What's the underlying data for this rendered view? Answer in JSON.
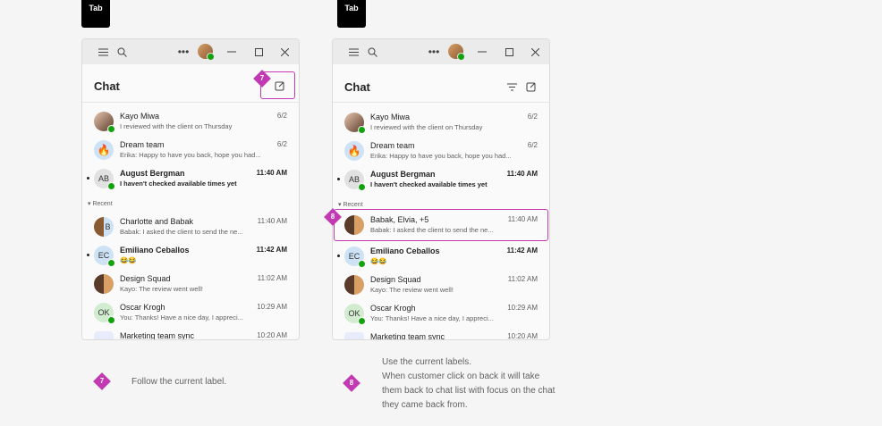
{
  "badges": {
    "tab_left": "Tab",
    "tab_right": "Tab"
  },
  "chat": {
    "title": "Chat",
    "recent_label": "Recent"
  },
  "markers": {
    "m7": "7",
    "m8": "8"
  },
  "left_rows": [
    {
      "name": "Kayo Miwa",
      "preview": "I reviewed with the client on Thursday",
      "time": "6/2"
    },
    {
      "name": "Dream team",
      "preview": "Erika: Happy to have you back, hope you had...",
      "time": "6/2"
    },
    {
      "name": "August Bergman",
      "preview": "I haven't checked available times yet",
      "time": "11:40 AM",
      "initials": "AB"
    },
    {
      "name": "Charlotte and Babak",
      "preview": "Babak: I asked the client to send the ne...",
      "time": "11:40 AM",
      "initials": "B"
    },
    {
      "name": "Emiliano Ceballos",
      "preview": "😂😂",
      "time": "11:42 AM",
      "initials": "EC"
    },
    {
      "name": "Design Squad",
      "preview": "Kayo: The review went well!",
      "time": "11:02 AM"
    },
    {
      "name": "Oscar Krogh",
      "preview": "You: Thanks! Have a nice day, I appreci...",
      "time": "10:29 AM",
      "initials": "OK"
    },
    {
      "name": "Marketing team sync",
      "preview": "",
      "time": "10:20 AM"
    }
  ],
  "right_rows": [
    {
      "name": "Kayo Miwa",
      "preview": "I reviewed with the client on Thursday",
      "time": "6/2"
    },
    {
      "name": "Dream team",
      "preview": "Erika: Happy to have you back, hope you had...",
      "time": "6/2"
    },
    {
      "name": "August Bergman",
      "preview": "I haven't checked available times yet",
      "time": "11:40 AM",
      "initials": "AB"
    },
    {
      "name": "Babak, Elvia, +5",
      "preview": "Babak: I asked the client to send the ne...",
      "time": "11:40 AM"
    },
    {
      "name": "Emiliano Ceballos",
      "preview": "😂😂",
      "time": "11:42 AM",
      "initials": "EC"
    },
    {
      "name": "Design Squad",
      "preview": "Kayo: The review went well!",
      "time": "11:02 AM"
    },
    {
      "name": "Oscar Krogh",
      "preview": "You: Thanks! Have a nice day, I appreci...",
      "time": "10:29 AM",
      "initials": "OK"
    },
    {
      "name": "Marketing team sync",
      "preview": "",
      "time": "10:20 AM"
    }
  ],
  "notes": {
    "n7": "Follow the current label.",
    "n8_l1": "Use the current labels.",
    "n8_l2": "When customer click on back it will take",
    "n8_l3": "them back to chat list with focus on the chat",
    "n8_l4": "they came back from."
  },
  "colors": {
    "accent": "#c239b3",
    "presence": "#13a10e"
  }
}
